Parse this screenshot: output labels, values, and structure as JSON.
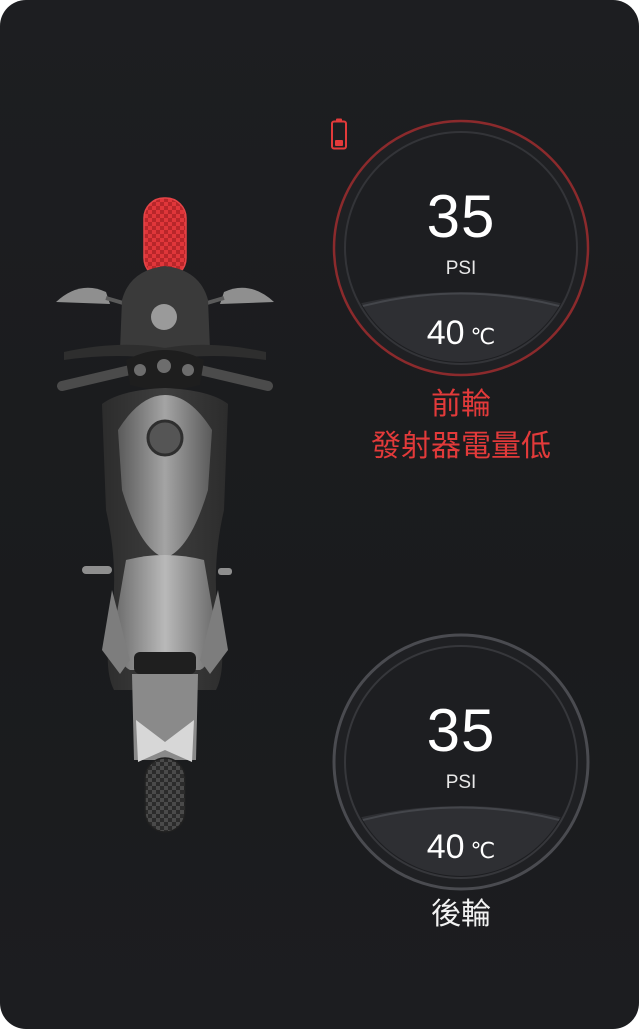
{
  "front_tire": {
    "pressure": "35",
    "pressure_unit": "PSI",
    "temperature": "40",
    "temperature_unit": "℃",
    "label_line1": "前輪",
    "label_line2": "發射器電量低",
    "status_color": "#e23a3a",
    "icon": "low-battery-icon"
  },
  "rear_tire": {
    "pressure": "35",
    "pressure_unit": "PSI",
    "temperature": "40",
    "temperature_unit": "℃",
    "label": "後輪",
    "status_color": "#8a8a8a"
  },
  "motorcycle": {
    "icon": "motorcycle-top-view-icon",
    "front_wheel_highlight_color": "#d12b2b"
  }
}
